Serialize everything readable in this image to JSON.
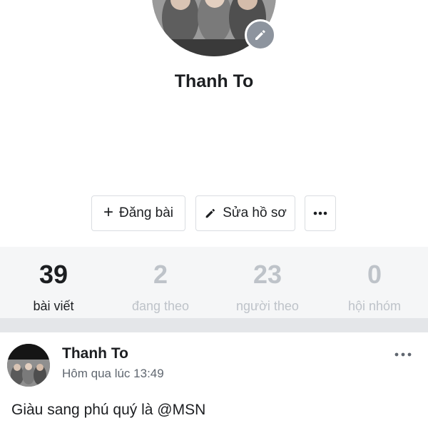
{
  "profile": {
    "name": "Thanh To",
    "avatar_icon": "profile-photo",
    "edit_icon": "pencil-icon"
  },
  "actions": {
    "post_label": "Đăng bài",
    "post_icon": "plus-icon",
    "edit_label": "Sửa hồ sơ",
    "edit_icon": "pencil-icon",
    "more_label": "•••"
  },
  "stats": [
    {
      "number": "39",
      "label": "bài viết",
      "active": true
    },
    {
      "number": "2",
      "label": "đang theo",
      "active": false
    },
    {
      "number": "23",
      "label": "người theo",
      "active": false
    },
    {
      "number": "0",
      "label": "hội nhóm",
      "active": false
    }
  ],
  "post": {
    "author": "Thanh To",
    "time": "Hôm qua lúc 13:49",
    "menu_label": "•••",
    "text": "Giàu sang phú quý là @MSN"
  },
  "colors": {
    "text_primary": "#1c1e21",
    "text_muted": "#bec3c9",
    "stats_bg": "#f5f6f7",
    "divider_bg": "#e4e6e9",
    "badge_bg": "#8d949e"
  }
}
